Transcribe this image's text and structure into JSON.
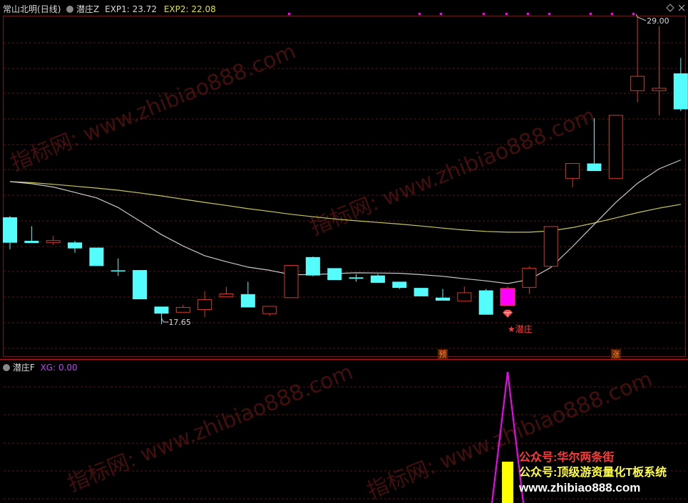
{
  "main_panel": {
    "stock_name": "常山北明",
    "period": "(日线)",
    "indicator_name": "潜庄Z",
    "exp1_label": "EXP1:",
    "exp1_value": "23.72",
    "exp2_label": "EXP2:",
    "exp2_value": "22.08",
    "high_label": "29.00",
    "low_label": "17.65",
    "signal_label": "★潜庄",
    "marker_yu": "预",
    "marker_zhang": "涨"
  },
  "sub_panel": {
    "indicator_name": "潜庄F",
    "xg_label": "XG:",
    "xg_value": "0.00"
  },
  "watermarks": {
    "site": "指标网: www.zhibiao888.com",
    "line1": "公众号:华尔两条街",
    "line2": "公众号:顶级游资量化T板系统",
    "line3": "www.zhibiao888.com"
  },
  "colors": {
    "up": "#d23a2a",
    "down": "#54fcfc",
    "signal_candle": "#ff00ff",
    "exp1_line": "#c8c8c8",
    "exp2_line": "#c8c85a",
    "xg_line": "#ff00ff",
    "xg_bar": "#ffff00",
    "exp2_text": "#e0e040",
    "xg_text": "#c040ff",
    "watermark_red": "#ff3a3a"
  },
  "chart_data": {
    "type": "candlestick",
    "candles": [
      {
        "o": 21.6,
        "h": 21.65,
        "c": 20.66,
        "l": 20.42,
        "dir": "down"
      },
      {
        "o": 20.73,
        "h": 21.27,
        "c": 20.65,
        "l": 20.65,
        "dir": "down"
      },
      {
        "o": 20.67,
        "h": 20.92,
        "c": 20.74,
        "l": 20.57,
        "dir": "up"
      },
      {
        "o": 20.67,
        "h": 20.73,
        "c": 20.45,
        "l": 20.29,
        "dir": "down"
      },
      {
        "o": 20.48,
        "h": 20.48,
        "c": 19.8,
        "l": 19.8,
        "dir": "down"
      },
      {
        "o": 19.64,
        "h": 20.08,
        "c": 19.64,
        "l": 19.44,
        "dir": "down"
      },
      {
        "o": 19.65,
        "h": 19.65,
        "c": 18.57,
        "l": 18.57,
        "dir": "down"
      },
      {
        "o": 18.3,
        "h": 18.3,
        "c": 18.04,
        "l": 17.65,
        "dir": "down"
      },
      {
        "o": 18.09,
        "h": 18.37,
        "c": 18.27,
        "l": 18.09,
        "dir": "up"
      },
      {
        "o": 18.19,
        "h": 18.87,
        "c": 18.56,
        "l": 17.91,
        "dir": "up"
      },
      {
        "o": 18.66,
        "h": 19.03,
        "c": 18.77,
        "l": 18.66,
        "dir": "up"
      },
      {
        "o": 18.76,
        "h": 19.22,
        "c": 18.27,
        "l": 18.27,
        "dir": "down"
      },
      {
        "o": 18.04,
        "h": 18.31,
        "c": 18.31,
        "l": 17.95,
        "dir": "up"
      },
      {
        "o": 18.63,
        "h": 19.82,
        "c": 19.82,
        "l": 18.63,
        "dir": "up"
      },
      {
        "o": 20.13,
        "h": 20.15,
        "c": 19.45,
        "l": 19.42,
        "dir": "down"
      },
      {
        "o": 19.72,
        "h": 19.72,
        "c": 19.28,
        "l": 19.28,
        "dir": "down"
      },
      {
        "o": 19.38,
        "h": 19.5,
        "c": 19.33,
        "l": 19.22,
        "dir": "down"
      },
      {
        "o": 19.45,
        "h": 19.51,
        "c": 19.18,
        "l": 19.18,
        "dir": "down"
      },
      {
        "o": 19.22,
        "h": 19.22,
        "c": 18.99,
        "l": 18.95,
        "dir": "down"
      },
      {
        "o": 18.99,
        "h": 18.99,
        "c": 18.68,
        "l": 18.68,
        "dir": "down"
      },
      {
        "o": 18.63,
        "h": 18.95,
        "c": 18.52,
        "l": 18.52,
        "dir": "down"
      },
      {
        "o": 18.5,
        "h": 19.04,
        "c": 18.81,
        "l": 18.5,
        "dir": "up"
      },
      {
        "o": 18.9,
        "h": 18.95,
        "c": 18.0,
        "l": 18.0,
        "dir": "down"
      },
      {
        "o": 18.34,
        "h": 19.04,
        "c": 18.97,
        "l": 18.34,
        "dir": "up",
        "signal": true
      },
      {
        "o": 19.01,
        "h": 19.79,
        "c": 19.72,
        "l": 18.77,
        "dir": "up"
      },
      {
        "o": 19.79,
        "h": 21.26,
        "c": 21.26,
        "l": 19.79,
        "dir": "up"
      },
      {
        "o": 23.04,
        "h": 23.04,
        "c": 23.59,
        "l": 22.71,
        "dir": "up"
      },
      {
        "o": 23.59,
        "h": 25.26,
        "c": 23.31,
        "l": 23.31,
        "dir": "down"
      },
      {
        "o": 23.04,
        "h": 25.37,
        "c": 25.37,
        "l": 23.04,
        "dir": "up"
      },
      {
        "o": 26.28,
        "h": 29.0,
        "c": 26.81,
        "l": 25.85,
        "dir": "up"
      },
      {
        "o": 26.28,
        "h": 28.66,
        "c": 26.37,
        "l": 25.37,
        "dir": "up"
      },
      {
        "o": 26.92,
        "h": 27.49,
        "c": 25.59,
        "l": 25.52,
        "dir": "down"
      }
    ],
    "exp1": [
      22.92,
      22.84,
      22.72,
      22.52,
      22.32,
      21.96,
      21.46,
      20.96,
      20.54,
      20.18,
      19.96,
      19.76,
      19.64,
      19.48,
      19.48,
      19.52,
      19.55,
      19.54,
      19.53,
      19.48,
      19.42,
      19.33,
      19.25,
      19.15,
      19.3,
      19.75,
      20.52,
      21.34,
      22.15,
      22.86,
      23.39,
      23.72
    ],
    "exp2": [
      22.92,
      22.88,
      22.82,
      22.75,
      22.68,
      22.6,
      22.5,
      22.39,
      22.27,
      22.15,
      22.04,
      21.92,
      21.82,
      21.71,
      21.62,
      21.54,
      21.47,
      21.41,
      21.35,
      21.28,
      21.2,
      21.13,
      21.08,
      21.05,
      21.05,
      21.1,
      21.22,
      21.39,
      21.58,
      21.77,
      21.94,
      22.08
    ],
    "xg_peak_index": 23,
    "marker_indices": {
      "yu": 20,
      "zhang": 28
    }
  }
}
